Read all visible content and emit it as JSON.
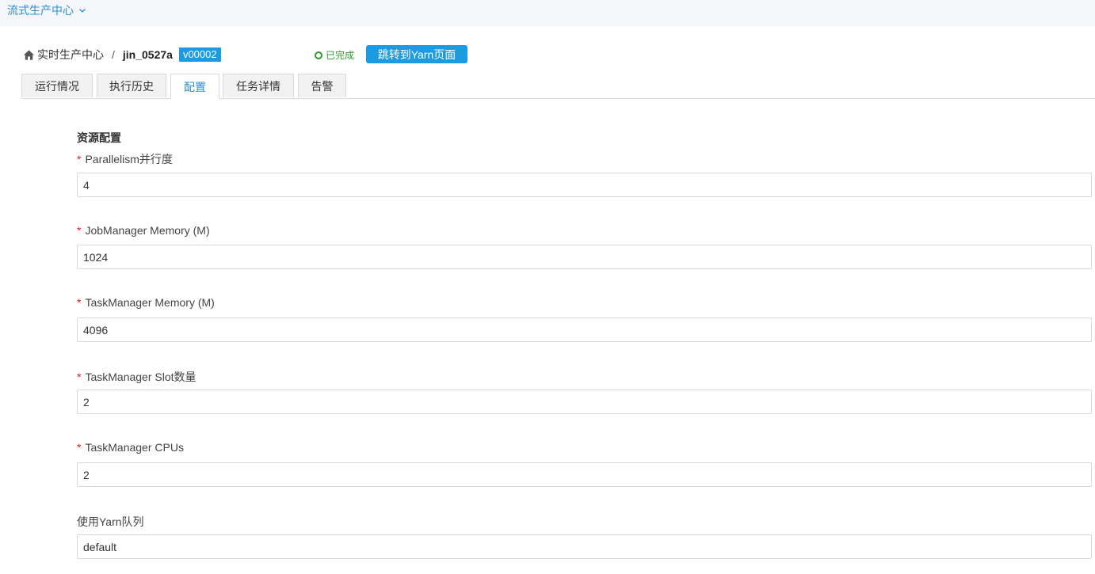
{
  "topbar": {
    "app_name": "流式生产中心"
  },
  "breadcrumb": {
    "home_label": "实时生产中心",
    "separator": "/",
    "job_name": "jin_0527a",
    "version": "v00002"
  },
  "status": {
    "label": "已完成",
    "color": "#2c9a2c"
  },
  "actions": {
    "yarn_button": "跳转到Yarn页面"
  },
  "tabs": [
    {
      "label": "运行情况",
      "active": false
    },
    {
      "label": "执行历史",
      "active": false
    },
    {
      "label": "配置",
      "active": true
    },
    {
      "label": "任务详情",
      "active": false
    },
    {
      "label": "告警",
      "active": false
    }
  ],
  "form": {
    "section_title": "资源配置",
    "fields": [
      {
        "label": "Parallelism并行度",
        "required": true,
        "value": "4"
      },
      {
        "label": "JobManager Memory (M)",
        "required": true,
        "value": "1024"
      },
      {
        "label": "TaskManager Memory (M)",
        "required": true,
        "value": "4096"
      },
      {
        "label": "TaskManager Slot数量",
        "required": true,
        "value": "2"
      },
      {
        "label": "TaskManager CPUs",
        "required": true,
        "value": "2"
      },
      {
        "label": "使用Yarn队列",
        "required": false,
        "value": "default"
      }
    ]
  },
  "colors": {
    "accent": "#1e9ae0",
    "link": "#2f8fd0",
    "required": "#e02020"
  }
}
